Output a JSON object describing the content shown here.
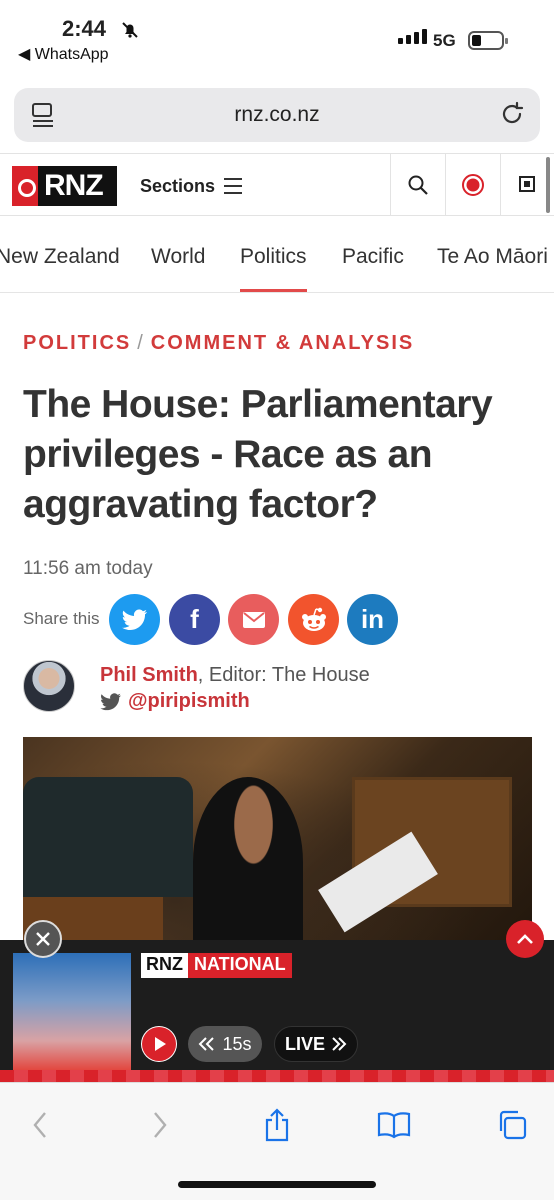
{
  "status_bar": {
    "time": "2:44",
    "back_app": "◀ WhatsApp",
    "network": "5G"
  },
  "browser": {
    "url": "rnz.co.nz"
  },
  "header": {
    "logo_text": "RNZ",
    "sections_label": "Sections"
  },
  "nav": {
    "items": [
      {
        "label": "New Zealand"
      },
      {
        "label": "World"
      },
      {
        "label": "Politics"
      },
      {
        "label": "Pacific"
      },
      {
        "label": "Te Ao Māori"
      }
    ],
    "active": "Politics"
  },
  "article": {
    "category": "POLITICS",
    "subcategory": "COMMENT & ANALYSIS",
    "category_separator": "/",
    "headline": "The House: Parliamentary privileges - Race as an aggravating factor?",
    "timestamp": "11:56 am today",
    "share_label": "Share this",
    "share_buttons": [
      {
        "icon": "twitter-icon",
        "color": "#1d9bf0"
      },
      {
        "icon": "facebook-icon",
        "color": "#3b4ba3",
        "glyph": "f"
      },
      {
        "icon": "email-icon",
        "color": "#e85d5d"
      },
      {
        "icon": "reddit-icon",
        "color": "#f2542d"
      },
      {
        "icon": "linkedin-icon",
        "color": "#1d7bbf",
        "glyph": "in"
      }
    ],
    "author_name": "Phil Smith",
    "author_role": ", Editor: The House",
    "author_handle": "@piripismith"
  },
  "player": {
    "brand_left": "RNZ",
    "brand_right": "NATIONAL",
    "skip_label": "15s",
    "live_label": "LIVE"
  },
  "colors": {
    "accent": "#d9222a",
    "crumb": "#d23b3b"
  }
}
